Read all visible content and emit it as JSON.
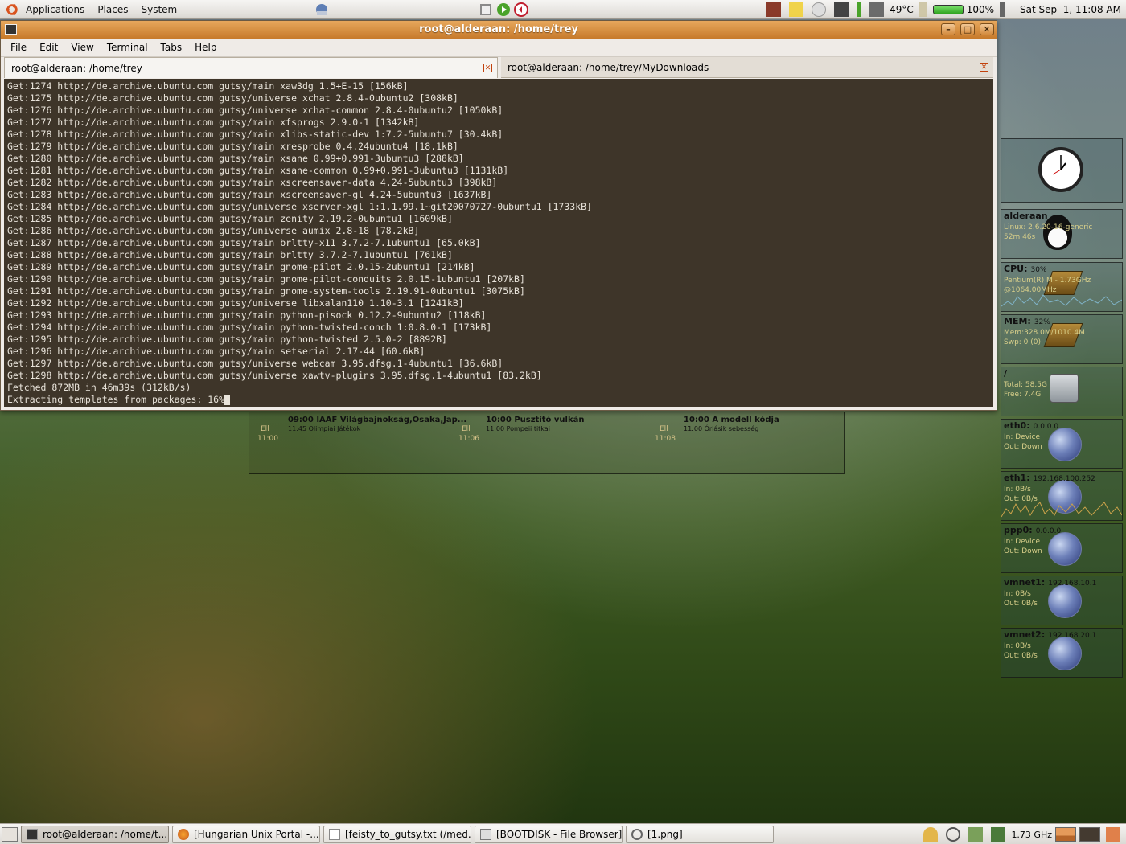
{
  "top_panel": {
    "menus": [
      "Applications",
      "Places",
      "System"
    ],
    "temperature": "49°C",
    "battery": "100%",
    "clock": "Sat Sep  1, 11:08 AM"
  },
  "window": {
    "title": "root@alderaan: /home/trey",
    "menu": [
      "File",
      "Edit",
      "View",
      "Terminal",
      "Tabs",
      "Help"
    ],
    "tabs": [
      {
        "label": "root@alderaan: /home/trey",
        "active": true
      },
      {
        "label": "root@alderaan: /home/trey/MyDownloads",
        "active": false
      }
    ],
    "lines": [
      "Get:1274 http://de.archive.ubuntu.com gutsy/main xaw3dg 1.5+E-15 [156kB]",
      "Get:1275 http://de.archive.ubuntu.com gutsy/universe xchat 2.8.4-0ubuntu2 [308kB]",
      "Get:1276 http://de.archive.ubuntu.com gutsy/universe xchat-common 2.8.4-0ubuntu2 [1050kB]",
      "Get:1277 http://de.archive.ubuntu.com gutsy/main xfsprogs 2.9.0-1 [1342kB]",
      "Get:1278 http://de.archive.ubuntu.com gutsy/main xlibs-static-dev 1:7.2-5ubuntu7 [30.4kB]",
      "Get:1279 http://de.archive.ubuntu.com gutsy/main xresprobe 0.4.24ubuntu4 [18.1kB]",
      "Get:1280 http://de.archive.ubuntu.com gutsy/main xsane 0.99+0.991-3ubuntu3 [288kB]",
      "Get:1281 http://de.archive.ubuntu.com gutsy/main xsane-common 0.99+0.991-3ubuntu3 [1131kB]",
      "Get:1282 http://de.archive.ubuntu.com gutsy/main xscreensaver-data 4.24-5ubuntu3 [398kB]",
      "Get:1283 http://de.archive.ubuntu.com gutsy/main xscreensaver-gl 4.24-5ubuntu3 [1637kB]",
      "Get:1284 http://de.archive.ubuntu.com gutsy/universe xserver-xgl 1:1.1.99.1~git20070727-0ubuntu1 [1733kB]",
      "Get:1285 http://de.archive.ubuntu.com gutsy/main zenity 2.19.2-0ubuntu1 [1609kB]",
      "Get:1286 http://de.archive.ubuntu.com gutsy/universe aumix 2.8-18 [78.2kB]",
      "Get:1287 http://de.archive.ubuntu.com gutsy/main brltty-x11 3.7.2-7.1ubuntu1 [65.0kB]",
      "Get:1288 http://de.archive.ubuntu.com gutsy/main brltty 3.7.2-7.1ubuntu1 [761kB]",
      "Get:1289 http://de.archive.ubuntu.com gutsy/main gnome-pilot 2.0.15-2ubuntu1 [214kB]",
      "Get:1290 http://de.archive.ubuntu.com gutsy/main gnome-pilot-conduits 2.0.15-1ubuntu1 [207kB]",
      "Get:1291 http://de.archive.ubuntu.com gutsy/main gnome-system-tools 2.19.91-0ubuntu1 [3075kB]",
      "Get:1292 http://de.archive.ubuntu.com gutsy/universe libxalan110 1.10-3.1 [1241kB]",
      "Get:1293 http://de.archive.ubuntu.com gutsy/main python-pisock 0.12.2-9ubuntu2 [118kB]",
      "Get:1294 http://de.archive.ubuntu.com gutsy/main python-twisted-conch 1:0.8.0-1 [173kB]",
      "Get:1295 http://de.archive.ubuntu.com gutsy/main python-twisted 2.5.0-2 [8892B]",
      "Get:1296 http://de.archive.ubuntu.com gutsy/main setserial 2.17-44 [60.6kB]",
      "Get:1297 http://de.archive.ubuntu.com gutsy/universe webcam 3.95.dfsg.1-4ubuntu1 [36.6kB]",
      "Get:1298 http://de.archive.ubuntu.com gutsy/universe xawtv-plugins 3.95.dfsg.1-4ubuntu1 [83.2kB]",
      "Fetched 872MB in 46m39s (312kB/s)",
      "Extracting templates from packages: 16%"
    ]
  },
  "tvguide": [
    {
      "title": "09:00 IAAF Világbajnokság,Osaka,Jap...",
      "next": "11:45 Olimpiai Játékok",
      "label": "Ell",
      "time": "11:00"
    },
    {
      "title": "10:00 Pusztító vulkán",
      "next": "11:00 Pompeii titkai",
      "label": "Ell",
      "time": "11:06"
    },
    {
      "title": "10:00 A modell kódja",
      "next": "11:00 Óriásik sebesség",
      "label": "Ell",
      "time": "11:08"
    }
  ],
  "monitors": {
    "host": {
      "name": "alderaan",
      "l1": "Linux: 2.6.20-16-generic",
      "l2": "52m 46s"
    },
    "cpu": {
      "name": "CPU:",
      "value": "30%",
      "l1": "Pentium(R) M - 1.73GHz",
      "l2": "@1064.00MHz"
    },
    "mem": {
      "name": "MEM:",
      "value": "32%",
      "l1": "Mem:328.0M/1010.4M",
      "l2": "Swp: 0 (0)"
    },
    "disk": {
      "name": "/",
      "l1": "Total: 58.5G",
      "l2": "Free: 7.4G"
    },
    "eth0": {
      "name": "eth0:",
      "ip": "0.0.0.0",
      "l1": "In:   Device",
      "l2": "Out: Down"
    },
    "eth1": {
      "name": "eth1:",
      "ip": "192.168.100.252",
      "l1": "In:   0B/s",
      "l2": "Out:  0B/s"
    },
    "ppp0": {
      "name": "ppp0:",
      "ip": "0.0.0.0",
      "l1": "In:   Device",
      "l2": "Out: Down"
    },
    "vmnet1": {
      "name": "vmnet1:",
      "ip": "192.168.10.1",
      "l1": "In:   0B/s",
      "l2": "Out:  0B/s"
    },
    "vmnet2": {
      "name": "vmnet2:",
      "ip": "192.168.20.1",
      "l1": "In:   0B/s",
      "l2": "Out:  0B/s"
    }
  },
  "taskbar": [
    "root@alderaan: /home/t...",
    "[Hungarian Unix Portal -...",
    "[feisty_to_gutsy.txt (/med...",
    "[BOOTDISK - File Browser]",
    "[1.png]"
  ],
  "bottom_tray": {
    "cpu_freq": "1.73 GHz"
  }
}
